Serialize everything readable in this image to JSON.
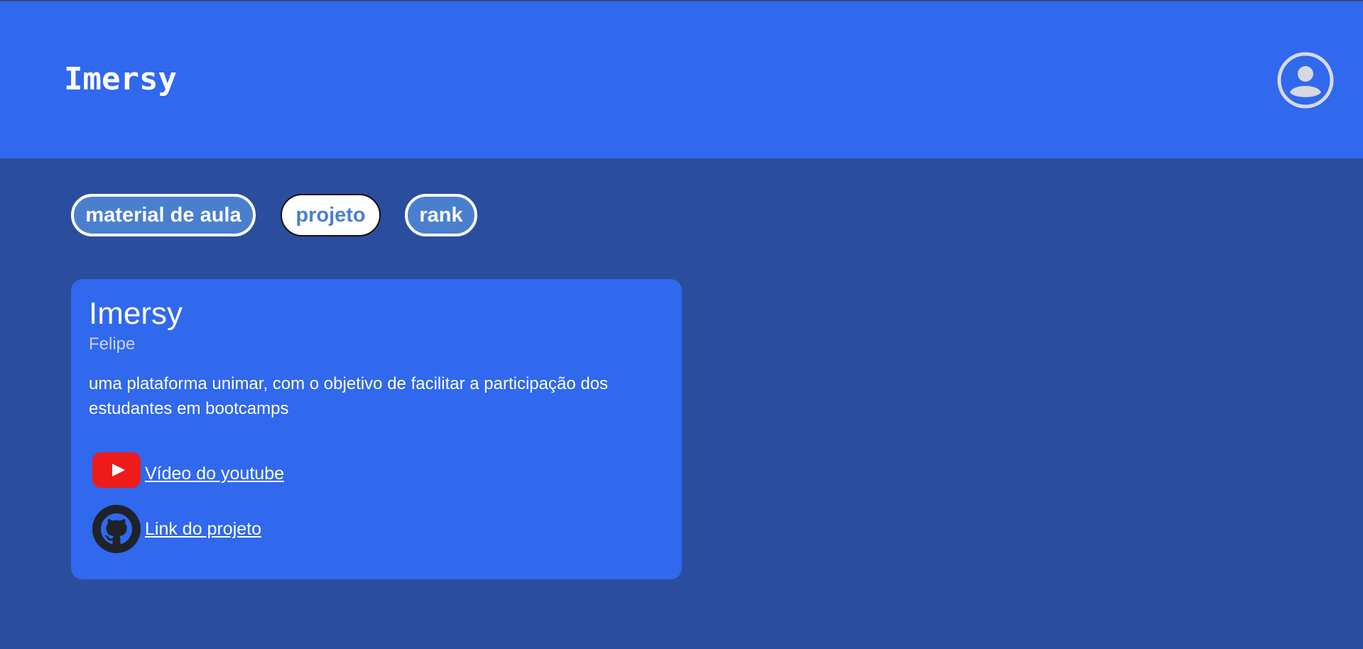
{
  "header": {
    "brand": "Imersy",
    "avatar_icon": "user-circle-icon"
  },
  "tabs": [
    {
      "label": "material de aula",
      "active": false
    },
    {
      "label": "projeto",
      "active": true
    },
    {
      "label": "rank",
      "active": false
    }
  ],
  "project": {
    "title": "Imersy",
    "author": "Felipe",
    "description": "uma plataforma unimar, com o objetivo de facilitar a participação dos estudantes em bootcamps",
    "links": [
      {
        "icon": "youtube-icon",
        "label": "Vídeo do youtube"
      },
      {
        "icon": "github-icon",
        "label": "Link do projeto"
      }
    ]
  },
  "colors": {
    "header_bg": "#3068ee",
    "page_bg": "#2b4d9e",
    "card_bg": "#3068ee",
    "tab_bg": "#4a7fcf",
    "youtube_red": "#ee1b1b"
  }
}
